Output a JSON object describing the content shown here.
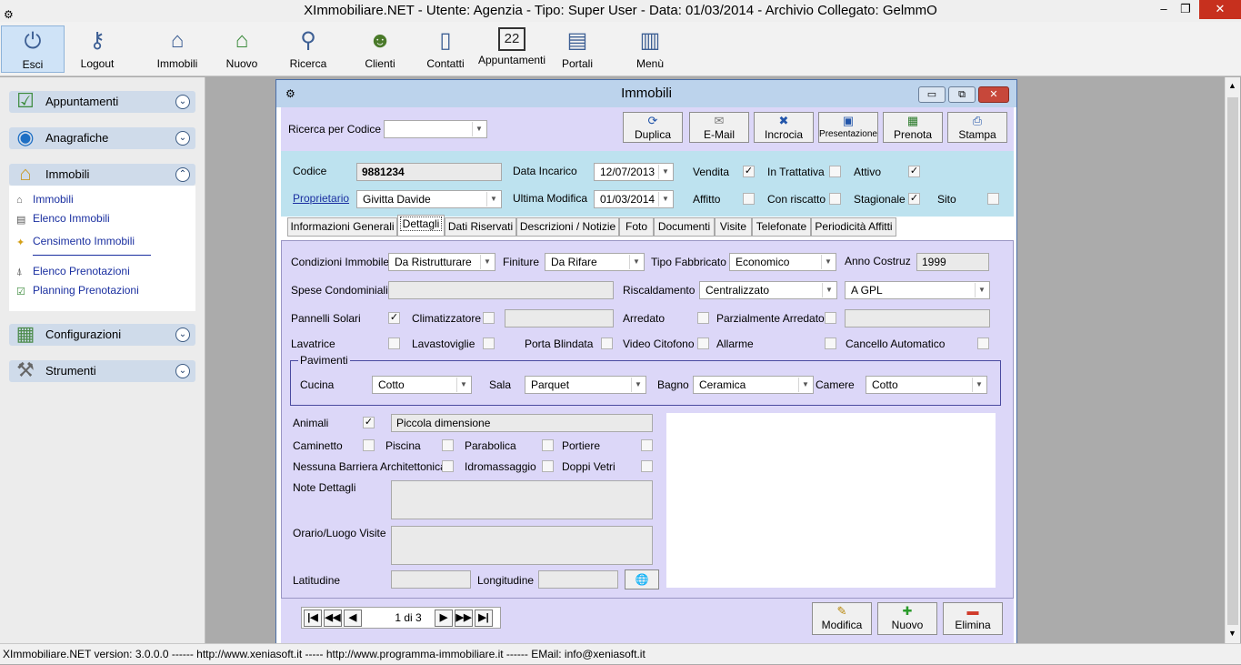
{
  "app": {
    "title": "XImmobiliare.NET - Utente: Agenzia - Tipo: Super User - Data: 01/03/2014 - Archivio Collegato: GelmmO",
    "controls": {
      "minimize": "–",
      "maximize": "❐",
      "close": "✕"
    }
  },
  "toolbar": [
    {
      "label": "Esci",
      "icon": "power-icon"
    },
    {
      "label": "Logout",
      "icon": "key-icon"
    },
    {
      "label": "Immobili",
      "icon": "house-icon"
    },
    {
      "label": "Nuovo",
      "icon": "house-new-icon"
    },
    {
      "label": "Ricerca",
      "icon": "magnifier-icon"
    },
    {
      "label": "Clienti",
      "icon": "users-icon"
    },
    {
      "label": "Contatti",
      "icon": "phone-icon"
    },
    {
      "label": "Appuntamenti",
      "icon": "calendar-icon"
    },
    {
      "label": "Portali",
      "icon": "portal-icon"
    },
    {
      "label": "Menù",
      "icon": "window-icon"
    }
  ],
  "sidebar": {
    "groups": [
      {
        "label": "Appuntamenti"
      },
      {
        "label": "Anagrafiche"
      },
      {
        "label": "Immobili"
      },
      {
        "label": "Configurazioni"
      },
      {
        "label": "Strumenti"
      }
    ],
    "immobili_items": [
      {
        "label": "Immobili"
      },
      {
        "label": "Elenco Immobili"
      },
      {
        "label": "Censimento Immobili"
      },
      {
        "label": "Elenco Prenotazioni"
      },
      {
        "label": "Planning Prenotazioni"
      }
    ]
  },
  "window": {
    "title": "Immobili",
    "search_label": "Ricerca per Codice",
    "search_value": "",
    "actions": [
      {
        "label": "Duplica",
        "icon": "refresh-icon"
      },
      {
        "label": "E-Mail",
        "icon": "envelope-icon"
      },
      {
        "label": "Incrocia",
        "icon": "cross-icon"
      },
      {
        "label": "Presentazione",
        "icon": "monitor-icon"
      },
      {
        "label": "Prenota",
        "icon": "calendar-small-icon"
      },
      {
        "label": "Stampa",
        "icon": "printer-icon"
      }
    ],
    "header": {
      "codice_label": "Codice",
      "codice": "9881234",
      "proprietario_label": "Proprietario",
      "proprietario": "Givitta Davide",
      "data_incarico_label": "Data Incarico",
      "data_incarico": "12/07/2013",
      "ultima_modifica_label": "Ultima Modifica",
      "ultima_modifica": "01/03/2014",
      "vendita": "Vendita",
      "affitto": "Affitto",
      "in_trattativa": "In Trattativa",
      "con_riscatto": "Con riscatto",
      "attivo": "Attivo",
      "stagionale": "Stagionale",
      "sito": "Sito"
    },
    "tabs": [
      {
        "label": "Informazioni Generali"
      },
      {
        "label": "Dettagli"
      },
      {
        "label": "Dati Riservati"
      },
      {
        "label": "Descrizioni / Notizie"
      },
      {
        "label": "Foto"
      },
      {
        "label": "Documenti"
      },
      {
        "label": "Visite"
      },
      {
        "label": "Telefonate"
      },
      {
        "label": "Periodicità Affitti"
      }
    ],
    "details": {
      "condizioni_label": "Condizioni Immobile",
      "condizioni": "Da Ristrutturare",
      "finiture_label": "Finiture",
      "finiture": "Da Rifare",
      "tipo_fabbricato_label": "Tipo Fabbricato",
      "tipo_fabbricato": "Economico",
      "anno_label": "Anno Costruz",
      "anno": "1999",
      "spese_label": "Spese Condominiali",
      "riscaldamento_label": "Riscaldamento",
      "riscaldamento": "Centralizzato",
      "combustibile": "A GPL",
      "pannelli_label": "Pannelli Solari",
      "climatizzatore_label": "Climatizzatore",
      "arredato_label": "Arredato",
      "parz_arredato_label": "Parzialmente Arredato",
      "lavatrice_label": "Lavatrice",
      "lavastoviglie_label": "Lavastoviglie",
      "porta_label": "Porta Blindata",
      "video_label": "Video Citofono",
      "allarme_label": "Allarme",
      "cancello_label": "Cancello Automatico",
      "pavimenti_legend": "Pavimenti",
      "cucina_label": "Cucina",
      "cucina": "Cotto",
      "sala_label": "Sala",
      "sala": "Parquet",
      "bagno_label": "Bagno",
      "bagno": "Ceramica",
      "camere_label": "Camere",
      "camere": "Cotto",
      "animali_label": "Animali",
      "animali": "Piccola dimensione",
      "caminetto_label": "Caminetto",
      "piscina_label": "Piscina",
      "parabolica_label": "Parabolica",
      "portiere_label": "Portiere",
      "barriera_label": "Nessuna Barriera Architettonica",
      "idromassaggio_label": "Idromassaggio",
      "doppi_vetri_label": "Doppi Vetri",
      "note_label": "Note Dettagli",
      "orario_label": "Orario/Luogo Visite",
      "latitudine_label": "Latitudine",
      "longitudine_label": "Longitudine"
    },
    "nav": {
      "position": "1 di 3",
      "first": "|◀",
      "prev_page": "◀◀",
      "prev": "◀",
      "next": "▶",
      "next_page": "▶▶",
      "last": "▶|"
    },
    "bottom_actions": [
      {
        "label": "Modifica",
        "icon": "pencil-icon"
      },
      {
        "label": "Nuovo",
        "icon": "plus-icon"
      },
      {
        "label": "Elimina",
        "icon": "minus-icon"
      }
    ]
  },
  "status": "XImmobiliare.NET version: 3.0.0.0 ------ http://www.xeniasoft.it ----- http://www.programma-immobiliare.it ------ EMail: info@xeniasoft.it"
}
